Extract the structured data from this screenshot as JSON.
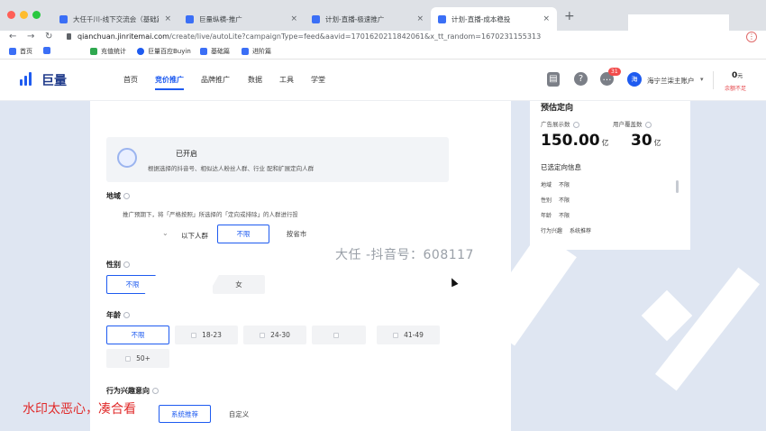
{
  "browser": {
    "tabs": [
      {
        "title": "大任千川-线下交流会（基础篇）",
        "active": false
      },
      {
        "title": "巨量纵横-推广",
        "active": false
      },
      {
        "title": "计划-直播-极速推广",
        "active": false
      },
      {
        "title": "计划-直播-成本稳投",
        "active": true
      }
    ],
    "url_host": "qianchuan.jinritemai.com",
    "url_path": "/create/live/autoLite?campaignType=feed&aavid=1701620211842061&x_tt_random=1670231155313",
    "bookmarks": [
      "首页",
      "充值统计",
      "巨量百应Buyin",
      "基础篇",
      "进阶篇"
    ]
  },
  "app": {
    "logo_text": "巨量",
    "nav": [
      "首页",
      "竞价推广",
      "品牌推广",
      "数据",
      "工具",
      "学堂"
    ],
    "active_nav": "竞价推广",
    "notif_count": "31",
    "avatar_letter": "海",
    "account_name": "海宁兰柒主账户",
    "balance_value": "0",
    "balance_unit": "元",
    "balance_warning": "余额不足"
  },
  "form": {
    "smart_title": "已开启",
    "smart_desc": "根据选择的抖音号、相似达人粉丝人群、行业              配和扩展定向人群",
    "region": {
      "label": "地域",
      "hint": "推广预期下，将「严格按照」所选择的「定向或排除」的人群进行投",
      "options": [
        "以下人群",
        "不限",
        "按省市"
      ],
      "selected": "不限"
    },
    "gender": {
      "label": "性别",
      "options": [
        "不限",
        "女"
      ],
      "selected": "不限"
    },
    "age": {
      "label": "年龄",
      "options": [
        "不限",
        "18-23",
        "24-30",
        "41-49",
        "50+"
      ],
      "selected": "不限"
    },
    "behavior": {
      "label": "行为兴趣意向",
      "options": [
        "系统推荐",
        "自定义"
      ],
      "selected": "系统推荐"
    }
  },
  "forecast": {
    "title": "预估定向",
    "impressions_label": "广告展示数",
    "impressions_value": "150.00",
    "impressions_unit": "亿",
    "users_label": "用户覆盖数",
    "users_value": "30",
    "users_unit": "亿",
    "selected_title": "已选定向信息",
    "rows": [
      {
        "k": "地域",
        "v": "不限"
      },
      {
        "k": "性别",
        "v": "不限"
      },
      {
        "k": "年龄",
        "v": "不限"
      },
      {
        "k": "行为兴趣",
        "v": "系统推荐"
      }
    ]
  },
  "overlay": {
    "watermark": "大任        -抖音号：608117",
    "caption": "水印太恶心，凑合看"
  },
  "colors": {
    "accent": "#1e5bf0",
    "warning": "#e5484d",
    "caption": "#e02b2b"
  }
}
